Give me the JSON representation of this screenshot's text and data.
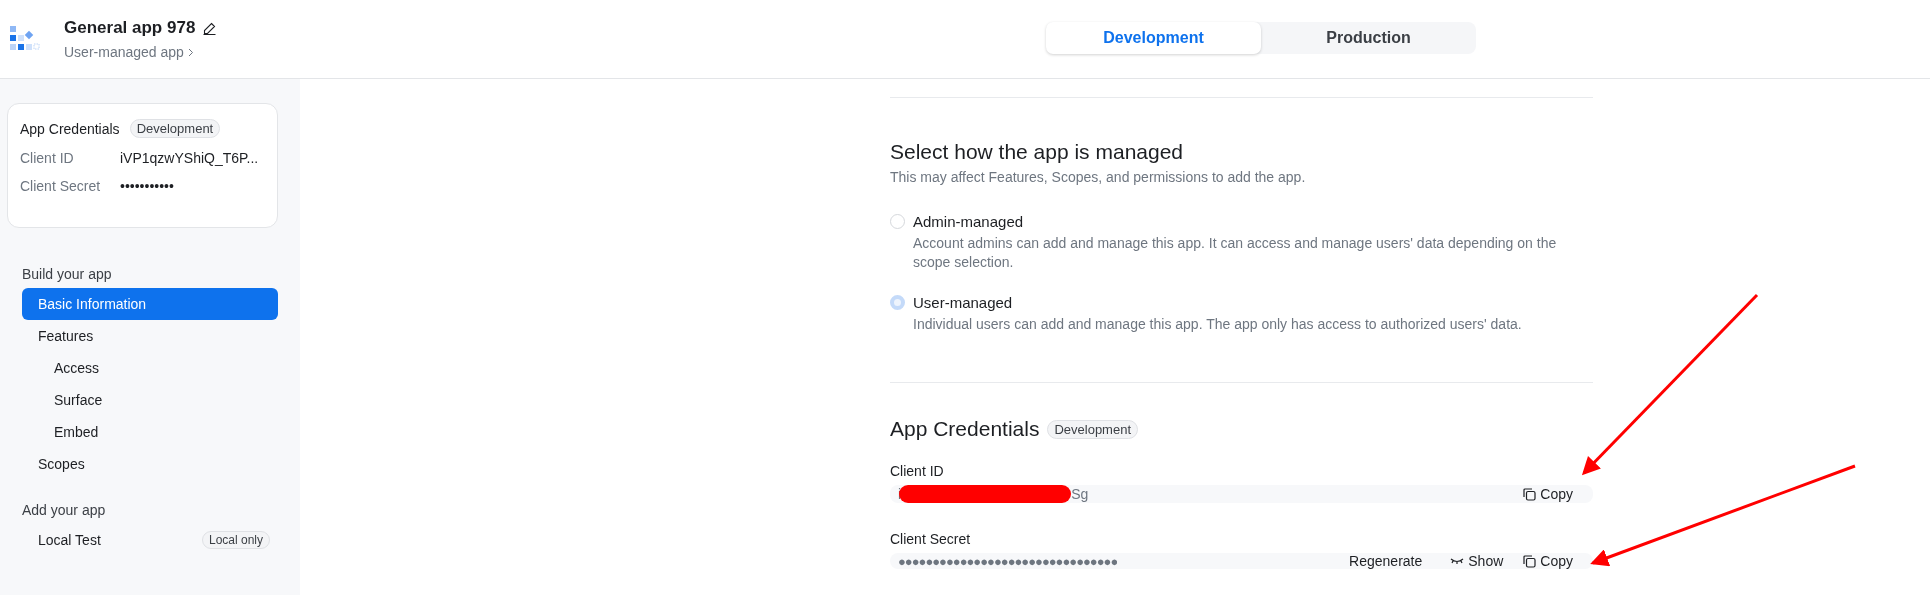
{
  "header": {
    "app_name": "General app 978",
    "app_type": "User-managed app",
    "env_tabs": [
      {
        "label": "Development",
        "selected": true
      },
      {
        "label": "Production",
        "selected": false
      }
    ]
  },
  "sidebar": {
    "credentials_card": {
      "title": "App Credentials",
      "badge": "Development",
      "rows": [
        {
          "label": "Client ID",
          "value": "iVP1qzwYShiQ_T6P..."
        },
        {
          "label": "Client Secret",
          "value": "•••••••••••"
        }
      ]
    },
    "sections": [
      {
        "title": "Build your app",
        "items": [
          {
            "label": "Basic Information",
            "selected": true
          },
          {
            "label": "Features",
            "selected": false,
            "children": [
              {
                "label": "Access",
                "selected": false
              },
              {
                "label": "Surface",
                "selected": false
              },
              {
                "label": "Embed",
                "selected": false
              }
            ]
          },
          {
            "label": "Scopes",
            "selected": false
          }
        ]
      },
      {
        "title": "Add your app",
        "items": [
          {
            "label": "Local Test",
            "selected": false,
            "badge": "Local only"
          }
        ]
      }
    ]
  },
  "management": {
    "title": "Select how the app is managed",
    "subtitle": "This may affect Features, Scopes, and permissions to add the app.",
    "options": [
      {
        "label": "Admin-managed",
        "description": "Account admins can add and manage this app. It can access and manage users' data depending on the scope selection.",
        "selected": false
      },
      {
        "label": "User-managed",
        "description": "Individual users can add and manage this app. The app only has access to authorized users' data.",
        "selected": true
      }
    ]
  },
  "credentials": {
    "title": "App Credentials",
    "badge": "Development",
    "client_id": {
      "label": "Client ID",
      "value_start": "i",
      "value_end": "Sg",
      "redacted": true,
      "actions": [
        "Copy"
      ]
    },
    "client_secret": {
      "label": "Client Secret",
      "masked_value": "●●●●●●●●●●●●●●●●●●●●●●●●●●●●●●●●",
      "actions": [
        "Regenerate",
        "Show",
        "Copy"
      ]
    }
  },
  "annotations": [
    {
      "kind": "arrow"
    },
    {
      "kind": "arrow"
    }
  ]
}
